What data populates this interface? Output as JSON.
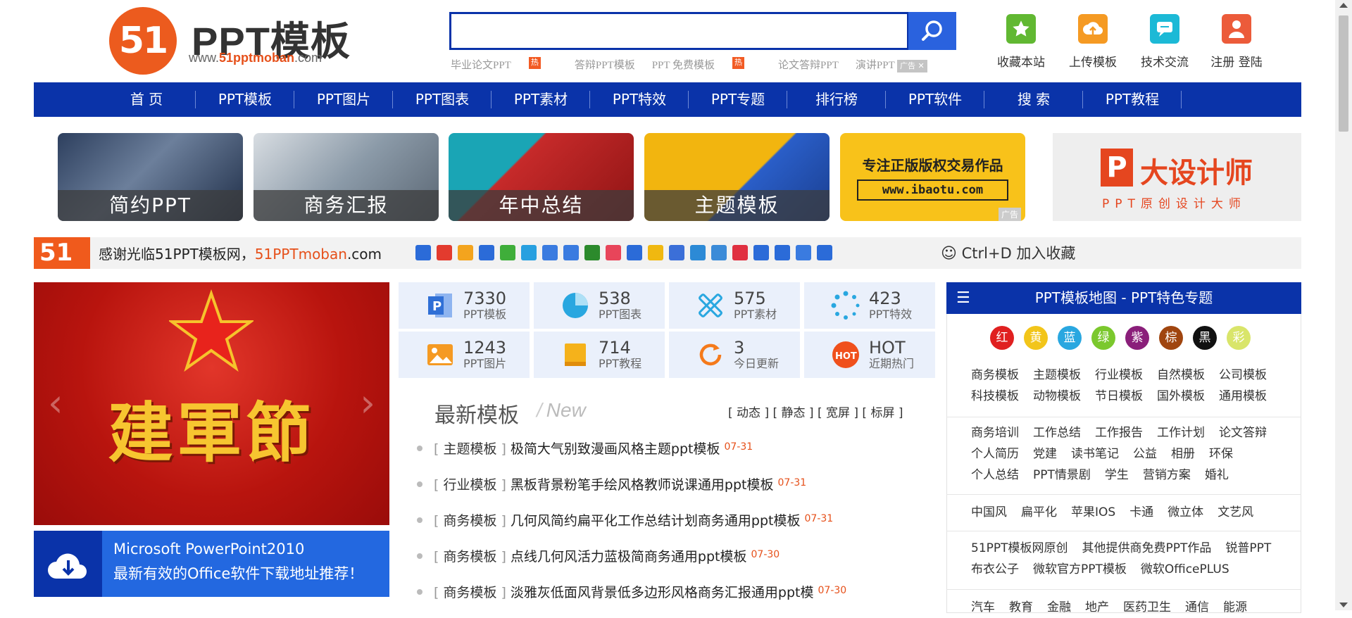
{
  "header": {
    "logo_number": "51",
    "logo_title": "PPT模板",
    "logo_url_pre": "www.",
    "logo_url_mid": "51pptmoban",
    "logo_url_post": ".com",
    "search_placeholder": "",
    "hot_links": [
      "毕业论文PPT",
      "答辩PPT模板",
      "PPT 免费模板",
      "论文答辩PPT",
      "演讲PPT"
    ],
    "hot_badge": "热",
    "ad_label": "广告",
    "actions": [
      {
        "label": "收藏本站",
        "color": "#61b832",
        "icon": "star-icon"
      },
      {
        "label": "上传模板",
        "color": "#f59a23",
        "icon": "upload-cloud-icon"
      },
      {
        "label": "技术交流",
        "color": "#1cb9d6",
        "icon": "chat-bubble-icon"
      },
      {
        "label": "注册 登陆",
        "color": "#ec5b3a",
        "icon": "user-icon"
      }
    ]
  },
  "nav": [
    "首 页",
    "PPT模板",
    "PPT图片",
    "PPT图表",
    "PPT素材",
    "PPT特效",
    "PPT专题",
    "排行榜",
    "PPT软件",
    "搜 索",
    "PPT教程"
  ],
  "banners": [
    {
      "caption": "简约PPT",
      "color": "#3b4f6e"
    },
    {
      "caption": "商务汇报",
      "color": "#8b9aa8"
    },
    {
      "caption": "年中总结",
      "color": "#c62a2a"
    },
    {
      "caption": "主题模板",
      "color": "#f2b50f"
    },
    {
      "caption": "",
      "color": "#f8c21a",
      "ad_text": "专注正版版权交易作品",
      "ad_url": "www.ibaotu.com",
      "ad_label": "广告"
    },
    {
      "caption": "",
      "color": "#eeeeee",
      "brand_title": "大设计师",
      "brand_sub": "PPT原创设计大师"
    }
  ],
  "welcome": {
    "logo": "51",
    "text": "感谢光临51PPT模板网，",
    "site_colored": "51PPTmoban",
    "site_suffix": ".com",
    "ctrl_text": "Ctrl+D 加入收藏",
    "share_colors": [
      "#2b6bd8",
      "#e33b2e",
      "#f3a41e",
      "#2b6bd8",
      "#3fae3a",
      "#28a0e0",
      "#3a7be0",
      "#3a7be0",
      "#2c8a2c",
      "#e8455a",
      "#2b6bd8",
      "#f0b810",
      "#3b6fd8",
      "#2c8ad6",
      "#3b8bd8",
      "#e03040",
      "#2b6bd8",
      "#2b6bd8",
      "#3a7be0",
      "#2b6bd8"
    ]
  },
  "slider": {
    "headline": "建軍節"
  },
  "office": {
    "line1": "Microsoft PowerPoint2010",
    "line2": "最新有效的Office软件下载地址推荐！"
  },
  "stats": [
    {
      "num": "7330",
      "label": "PPT模板",
      "icon": "ppt-file-icon",
      "color": "#2f6fd6"
    },
    {
      "num": "538",
      "label": "PPT图表",
      "icon": "pie-chart-icon",
      "color": "#29a7e0"
    },
    {
      "num": "575",
      "label": "PPT素材",
      "icon": "tools-icon",
      "color": "#29a7e0"
    },
    {
      "num": "423",
      "label": "PPT特效",
      "icon": "loading-dots-icon",
      "color": "#29a7e0"
    },
    {
      "num": "1243",
      "label": "PPT图片",
      "icon": "image-icon",
      "color": "#f59a23"
    },
    {
      "num": "714",
      "label": "PPT教程",
      "icon": "book-icon",
      "color": "#f5b21b"
    },
    {
      "num": "3",
      "label": "今日更新",
      "icon": "refresh-icon",
      "color": "#f57a1b"
    },
    {
      "num": "HOT",
      "label": "近期热门",
      "icon": "hot-badge-icon",
      "color": "#f0501c"
    }
  ],
  "latest": {
    "title": "最新模板",
    "title_en": "New",
    "filters": "[ 动态 ] [ 静态 ] [ 宽屏 ] [ 标屏 ]",
    "items": [
      {
        "cat": "主题模板",
        "title": "极简大气别致漫画风格主题ppt模板",
        "date": "07-31"
      },
      {
        "cat": "行业模板",
        "title": "黑板背景粉笔手绘风格教师说课通用ppt模板",
        "date": "07-31"
      },
      {
        "cat": "商务模板",
        "title": "几何风简约扁平化工作总结计划商务通用ppt模板",
        "date": "07-31"
      },
      {
        "cat": "商务模板",
        "title": "点线几何风活力蓝极简商务通用ppt模板",
        "date": "07-30"
      },
      {
        "cat": "商务模板",
        "title": "淡雅灰低面风背景低多边形风格商务汇报通用ppt模",
        "date": "07-30"
      }
    ]
  },
  "right_panel": {
    "title": "PPT模板地图 - PPT特色专题",
    "colors": [
      {
        "label": "红",
        "color": "#e02020"
      },
      {
        "label": "黄",
        "color": "#f2c51a"
      },
      {
        "label": "蓝",
        "color": "#29a7e0"
      },
      {
        "label": "绿",
        "color": "#7bc82d"
      },
      {
        "label": "紫",
        "color": "#8a1f7a"
      },
      {
        "label": "棕",
        "color": "#a0450f"
      },
      {
        "label": "黑",
        "color": "#111111"
      },
      {
        "label": "彩",
        "color": "#d9e56a"
      }
    ],
    "groups": [
      [
        "商务模板",
        "主题模板",
        "行业模板",
        "自然模板",
        "公司模板",
        "科技模板",
        "动物模板",
        "节日模板",
        "国外模板",
        "通用模板"
      ],
      [
        "商务培训",
        "工作总结",
        "工作报告",
        "工作计划",
        "论文答辩",
        "个人简历",
        "党建",
        "读书笔记",
        "公益",
        "相册",
        "环保",
        "个人总结",
        "PPT情景剧",
        "学生",
        "营销方案",
        "婚礼"
      ],
      [
        "中国风",
        "扁平化",
        "苹果IOS",
        "卡通",
        "微立体",
        "文艺风"
      ],
      [
        "51PPT模板网原创",
        "其他提供商免费PPT作品",
        "锐普PPT",
        "布衣公子",
        "微软官方PPT模板",
        "微软OfficePLUS"
      ],
      [
        "汽车",
        "教育",
        "金融",
        "地产",
        "医药卫生",
        "通信",
        "能源"
      ]
    ]
  }
}
